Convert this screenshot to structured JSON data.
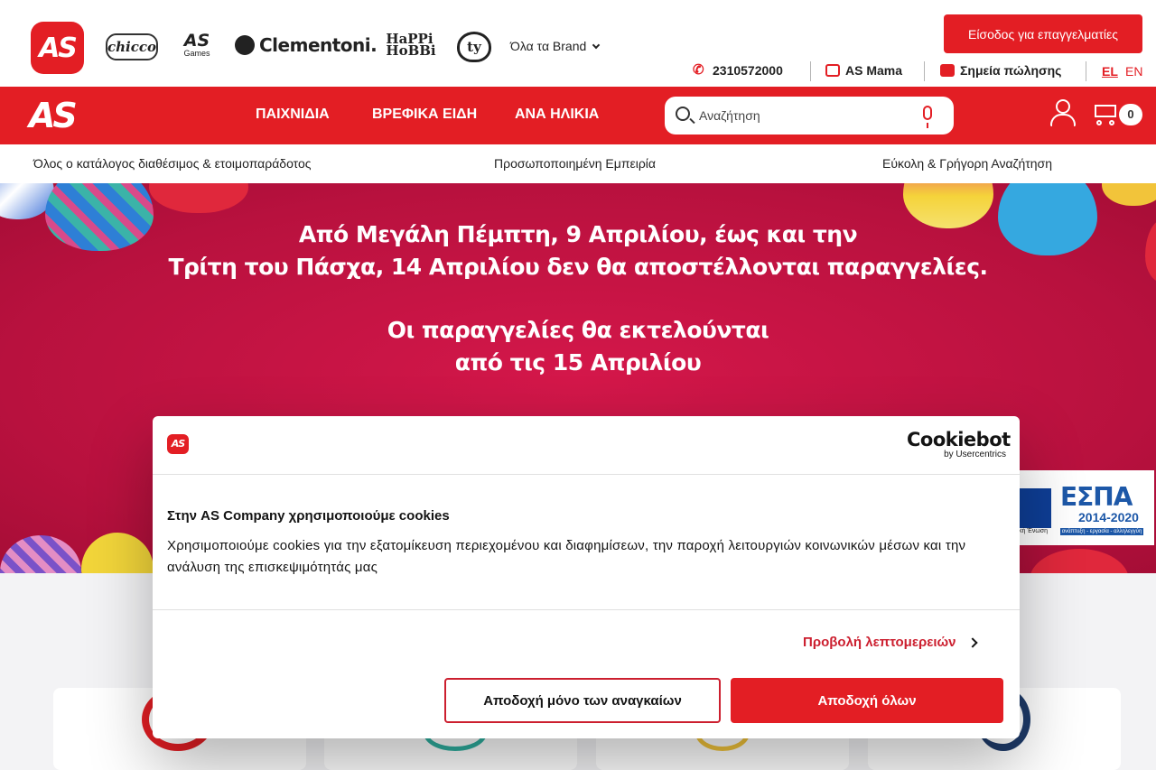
{
  "header": {
    "logo_text": "AS",
    "brands": [
      {
        "name": "chicco",
        "icon": "chicco-logo"
      },
      {
        "name": "AS Games",
        "icon": "as-games-logo"
      },
      {
        "name": "Clementoni",
        "icon": "clementoni-logo"
      },
      {
        "name": "Happy Hobby",
        "icon": "happy-hobby-logo"
      },
      {
        "name": "ty",
        "icon": "ty-logo"
      }
    ],
    "chicco_label": "chicco",
    "asgames_a": "AS",
    "asgames_b": "Games",
    "clementoni_label": "Clementoni.",
    "happy_label": "HaPPi HoBBi",
    "ty_label": "ty",
    "all_brands_label": "Όλα τα Brand",
    "pro_button_label": "Είσοδος για επαγγελματίες",
    "phone": "2310572000",
    "mama_label": "AS Mama",
    "shops_label": "Σημεία πώλησης",
    "lang_el": "EL",
    "lang_en": "EN"
  },
  "nav": {
    "logo_text": "AS",
    "items": [
      "ΠΑΙΧΝΙΔΙΑ",
      "ΒΡΕΦΙΚΑ ΕΙΔΗ",
      "ΑΝΑ ΗΛΙΚΙΑ"
    ],
    "search_placeholder": "Αναζήτηση",
    "cart_count": "0"
  },
  "benefits": [
    "Όλος ο κατάλογος διαθέσιμος & ετοιμοπαράδοτος",
    "Προσωποποιημένη Εμπειρία",
    "Εύκολη & Γρήγορη Αναζήτηση"
  ],
  "hero": {
    "line1": "Από Μεγάλη Πέμπτη, 9 Απριλίου, έως και την",
    "line2": "Τρίτη του Πάσχα, 14 Απριλίου δεν θα αποστέλλονται παραγγελίες.",
    "line3": "Οι παραγγελίες θα εκτελούνται",
    "line4": "από τις 15 Απριλίου",
    "espa_title": "ΕΣΠΑ",
    "espa_years": "2014-2020",
    "espa_tag": "ανάπτυξη - εργασία - αλληλεγγύη",
    "eu_text": "κή Ένωση"
  },
  "cookie": {
    "logo_text": "AS",
    "brand_title": "Cookiebot",
    "brand_sub": "by Usercentrics",
    "title": "Στην AS Company χρησιμοποιούμε cookies",
    "text": "Χρησιμοποιούμε cookies για την εξατομίκευση περιεχομένου και διαφημίσεων, την παροχή λειτουργιών κοινωνικών μέσων και την ανάλυση της επισκεψιμότητάς μας",
    "details_label": "Προβολή λεπτομερειών",
    "necessary_label": "Αποδοχή μόνο των αναγκαίων",
    "accept_all_label": "Αποδοχή όλων"
  },
  "colors": {
    "brand_red": "#e31e24",
    "hero_bg": "#b8113e",
    "cookie_red": "#cc1f2f"
  }
}
